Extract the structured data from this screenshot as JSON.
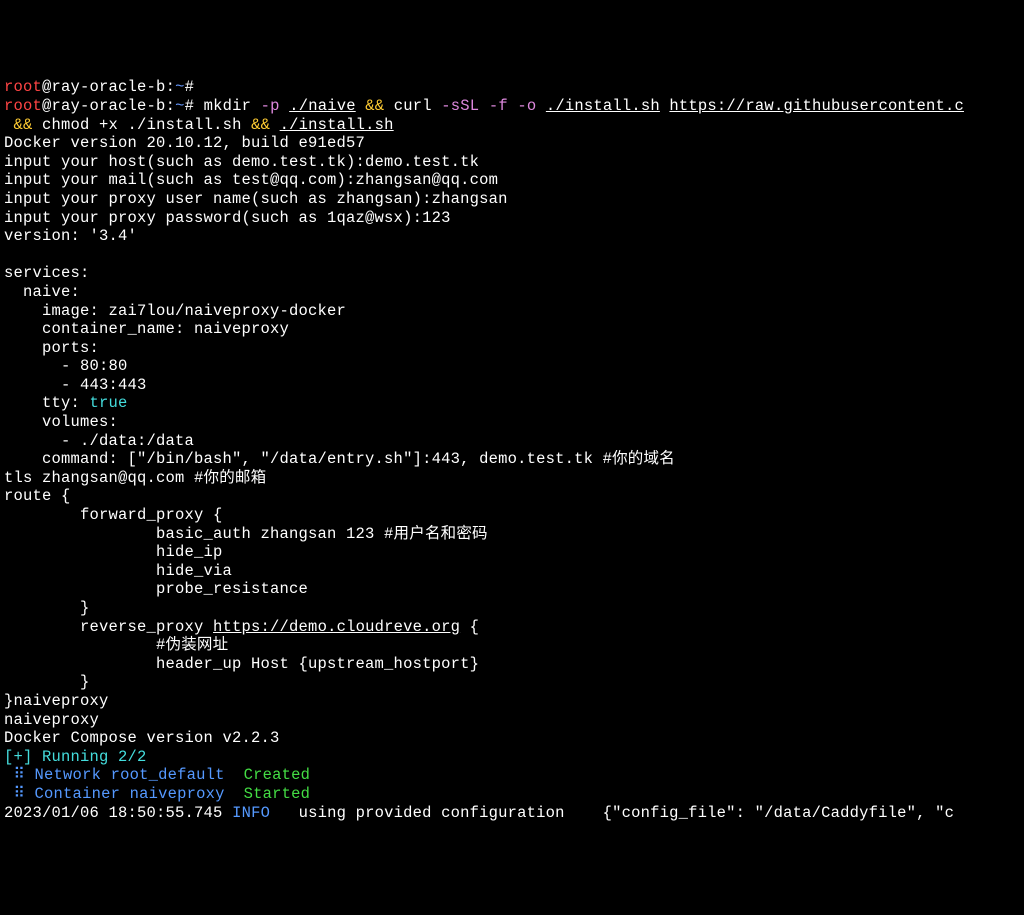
{
  "prompt": {
    "user": "root",
    "host": "ray-oracle-b",
    "path": "~",
    "sep": ":",
    "end": "#"
  },
  "line1_empty": " ",
  "cmd": {
    "mkdir": "mkdir",
    "opt_p": "-p",
    "path": "./naive",
    "and": "&&",
    "curl": "curl",
    "opt_ssl": "-sSL",
    "opt_f": "-f",
    "opt_o": "-o",
    "outfile": "./install.sh",
    "url": "https://raw.githubusercontent.c",
    "chmod": "chmod +x ./install.sh",
    "run": "./install.sh"
  },
  "docker_version": "Docker version 20.10.12, build e91ed57",
  "inputs": {
    "host": "input your host(such as demo.test.tk):demo.test.tk",
    "mail": "input your mail(such as test@qq.com):zhangsan@qq.com",
    "proxy_user": "input your proxy user name(such as zhangsan):zhangsan",
    "proxy_pass": "input your proxy password(such as 1qaz@wsx):123"
  },
  "yaml": {
    "version": "version: '3.4'",
    "services": "services:",
    "naive": "  naive:",
    "image": "    image: zai7lou/naiveproxy-docker",
    "container_name": "    container_name: naiveproxy",
    "ports": "    ports:",
    "port80": "      - 80:80",
    "port443": "      - 443:443",
    "tty": "    tty:",
    "tty_true": "true",
    "volumes": "    volumes:",
    "vol1": "      - ./data:/data",
    "command": "    command: [\"/bin/bash\", \"/data/entry.sh\"]:443, demo.test.tk #你的域名"
  },
  "config": {
    "tls": "tls zhangsan@qq.com #你的邮箱",
    "route": "route {",
    "fwd_proxy": "        forward_proxy {",
    "basic_auth": "                basic_auth zhangsan 123 #用户名和密码",
    "hide_ip": "                hide_ip",
    "hide_via": "                hide_via",
    "probe": "                probe_resistance",
    "close1": "        }",
    "rev_proxy_pre": "        reverse_proxy ",
    "rev_proxy_url": "https://demo.cloudreve.org",
    "rev_proxy_post": " {",
    "comment_fake": "                #伪装网址",
    "header_up": "                header_up Host {upstream_hostport}",
    "close2": "        }",
    "close3": "}naiveproxy"
  },
  "output": {
    "naiveproxy": "naiveproxy",
    "compose_version": "Docker Compose version v2.2.3",
    "running": "[+] Running 2/2",
    "network_line": " ⠿ Network root_default  ",
    "network_status": "Created",
    "container_line": " ⠿ Container naiveproxy  ",
    "container_status": "Started",
    "log_time": "2023/01/06 18:50:55.745",
    "log_level": "INFO",
    "log_msg": "   using provided configuration    {\"config_file\": \"/data/Caddyfile\", \"c"
  }
}
